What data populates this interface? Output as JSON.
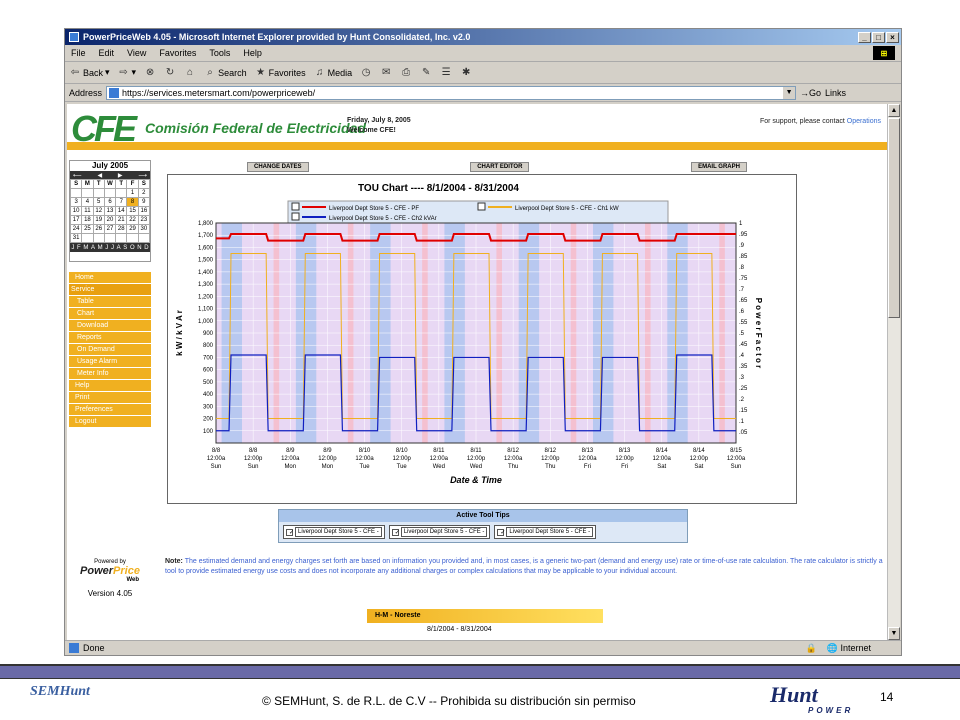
{
  "window": {
    "title": "PowerPriceWeb 4.05 - Microsoft Internet Explorer provided by Hunt Consolidated, Inc. v2.0",
    "menu": [
      "File",
      "Edit",
      "View",
      "Favorites",
      "Tools",
      "Help"
    ],
    "toolbar": {
      "back": "Back",
      "search": "Search",
      "favorites": "Favorites",
      "media": "Media"
    },
    "address_label": "Address",
    "url": "https://services.metersmart.com/powerpriceweb/",
    "go": "Go",
    "links": "Links",
    "status": "Done",
    "zone": "Internet"
  },
  "header": {
    "logo": "CFE",
    "org": "Comisión Federal de Electricidad",
    "date": "Friday, July 8, 2005",
    "welcome": "Welcome CFE!",
    "support": "For support, please contact",
    "support_link": "Operations"
  },
  "calendar": {
    "title": "July 2005",
    "days": [
      "S",
      "M",
      "T",
      "W",
      "T",
      "F",
      "S"
    ],
    "weeks": [
      [
        "",
        "",
        "",
        "",
        "",
        "1",
        "2"
      ],
      [
        "3",
        "4",
        "5",
        "6",
        "7",
        "8",
        "9"
      ],
      [
        "10",
        "11",
        "12",
        "13",
        "14",
        "15",
        "16"
      ],
      [
        "17",
        "18",
        "19",
        "20",
        "21",
        "22",
        "23"
      ],
      [
        "24",
        "25",
        "26",
        "27",
        "28",
        "29",
        "30"
      ],
      [
        "31",
        "",
        "",
        "",
        "",
        "",
        ""
      ]
    ],
    "months": [
      "J",
      "F",
      "M",
      "A",
      "M",
      "J",
      "J",
      "A",
      "S",
      "O",
      "N",
      "D"
    ]
  },
  "nav": [
    "Home",
    "Service",
    "Table",
    "Chart",
    "Download",
    "Reports",
    "On Demand",
    "Usage Alarm",
    "Meter Info",
    "Help",
    "Print",
    "Preferences",
    "Logout"
  ],
  "powered": {
    "by": "Powered by",
    "name1": "Power",
    "name2": "Price",
    "web": "Web",
    "version": "Version 4.05"
  },
  "buttons": [
    "CHANGE DATES",
    "CHART EDITOR",
    "EMAIL GRAPH"
  ],
  "chart_data": {
    "type": "line",
    "title": "TOU Chart",
    "range": "8/1/2004 - 8/31/2004",
    "title_sep": "----",
    "xlabel": "Date & Time",
    "ylabel": "k W  /  k V A r",
    "y2label": "P o w e r   F a c t o r",
    "ylim": [
      0,
      1800
    ],
    "y2lim": [
      0,
      1
    ],
    "yticks": [
      "100",
      "200",
      "300",
      "400",
      "500",
      "600",
      "700",
      "800",
      "900",
      "1,000",
      "1,100",
      "1,200",
      "1,300",
      "1,400",
      "1,500",
      "1,600",
      "1,700",
      "1,800"
    ],
    "y2ticks": [
      ".05",
      ".1",
      ".15",
      ".2",
      ".25",
      ".3",
      ".35",
      ".4",
      ".45",
      ".5",
      ".55",
      ".6",
      ".65",
      ".7",
      ".75",
      ".8",
      ".85",
      ".9",
      ".95",
      "1"
    ],
    "xticks": [
      [
        "8/8",
        "12:00a",
        "Sun"
      ],
      [
        "8/8",
        "12:00p",
        "Sun"
      ],
      [
        "8/9",
        "12:00a",
        "Mon"
      ],
      [
        "8/9",
        "12:00p",
        "Mon"
      ],
      [
        "8/10",
        "12:00a",
        "Tue"
      ],
      [
        "8/10",
        "12:00p",
        "Tue"
      ],
      [
        "8/11",
        "12:00a",
        "Wed"
      ],
      [
        "8/11",
        "12:00p",
        "Wed"
      ],
      [
        "8/12",
        "12:00a",
        "Thu"
      ],
      [
        "8/12",
        "12:00p",
        "Thu"
      ],
      [
        "8/13",
        "12:00a",
        "Fri"
      ],
      [
        "8/13",
        "12:00p",
        "Fri"
      ],
      [
        "8/14",
        "12:00a",
        "Sat"
      ],
      [
        "8/14",
        "12:00p",
        "Sat"
      ],
      [
        "8/15",
        "12:00a",
        "Sun"
      ]
    ],
    "legend": [
      {
        "name": "Liverpool Dept Store 5 - CFE - PF",
        "color": "#e00000"
      },
      {
        "name": "Liverpool Dept Store 5 - CFE - Ch1 kW",
        "color": "#f0b020"
      },
      {
        "name": "Liverpool Dept Store 5 - CFE - Ch2 kVAr",
        "color": "#1020c0"
      }
    ],
    "series": [
      {
        "name": "Liverpool Dept Store 5 - CFE - Ch1 kW",
        "values": [
          200,
          1550,
          200,
          1550,
          200,
          1550,
          200,
          1550,
          200,
          1550,
          200,
          1550,
          200,
          1550,
          200
        ]
      },
      {
        "name": "Liverpool Dept Store 5 - CFE - Ch2 kVAr",
        "values": [
          100,
          720,
          100,
          720,
          100,
          700,
          100,
          700,
          100,
          700,
          100,
          700,
          100,
          720,
          100
        ]
      },
      {
        "name": "Liverpool Dept Store 5 - CFE - PF",
        "values": [
          0.93,
          0.95,
          0.92,
          0.95,
          0.92,
          0.95,
          0.92,
          0.95,
          0.92,
          0.95,
          0.92,
          0.95,
          0.92,
          0.95,
          0.95
        ]
      }
    ]
  },
  "tooltips": {
    "title": "Active Tool Tips",
    "items": [
      "Liverpool Dept Store 5 - CFE -",
      "Liverpool Dept Store 5 - CFE -",
      "Liverpool Dept Store 5 - CFE -"
    ]
  },
  "note": {
    "label": "Note:",
    "text": "The estimated demand and energy charges set forth are based on information you provided and, in most cases, is a generic two-part (demand and energy use) rate or time-of-use rate calculation. The rate calculator is strictly a tool to provide estimated energy use costs and does not incorporate any additional charges or complex calculations that may be applicable to your individual account."
  },
  "rate": {
    "name": "H-M - Noreste",
    "range": "8/1/2004 - 8/31/2004"
  },
  "footer": {
    "copyright": "© SEMHunt, S. de R.L. de C.V -- Prohibida su distribución sin permiso",
    "page": "14",
    "hunt": "Hunt",
    "power": "POWER",
    "sem": "SEMHunt"
  }
}
